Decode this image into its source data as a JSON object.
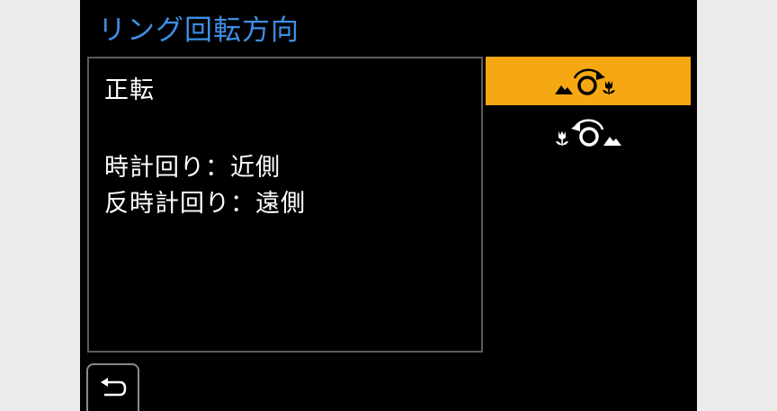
{
  "menu": {
    "title": "リング回転方向"
  },
  "description": {
    "heading": "正転",
    "line1": "時計回り：近側",
    "line2": "反時計回り：遠側"
  },
  "options": [
    {
      "name": "normal",
      "icon": "rotate-clockwise-near-icon",
      "selected": true
    },
    {
      "name": "reverse",
      "icon": "rotate-counterclockwise-far-icon",
      "selected": false
    }
  ],
  "colors": {
    "title": "#3d8fe6",
    "selected_bg": "#f5a811",
    "background": "#000000",
    "text": "#ffffff",
    "panel_border": "#5c5c5c"
  },
  "back": {
    "icon": "return-arrow-icon"
  }
}
